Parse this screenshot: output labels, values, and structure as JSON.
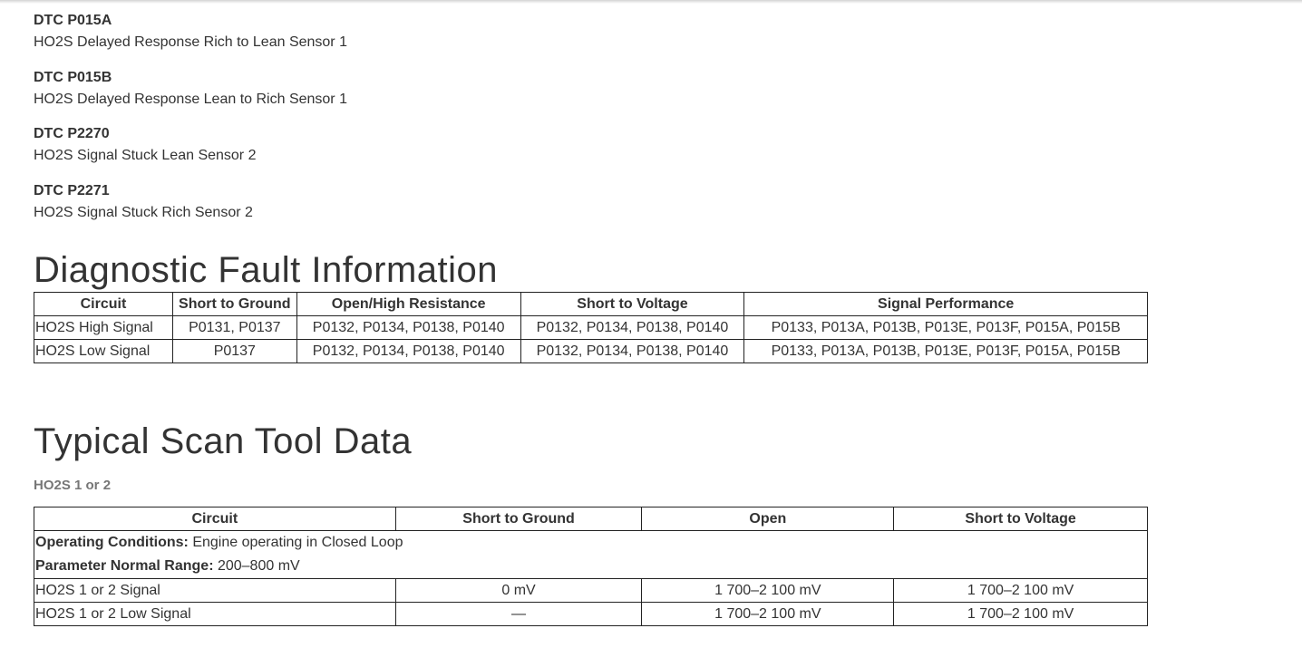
{
  "dtcs": [
    {
      "code": "DTC P015A",
      "desc": "HO2S Delayed Response Rich to Lean Sensor 1"
    },
    {
      "code": "DTC P015B",
      "desc": "HO2S Delayed Response Lean to Rich Sensor 1"
    },
    {
      "code": "DTC P2270",
      "desc": "HO2S Signal Stuck Lean Sensor 2"
    },
    {
      "code": "DTC P2271",
      "desc": "HO2S Signal Stuck Rich Sensor 2"
    }
  ],
  "fault_info": {
    "title": "Diagnostic Fault Information",
    "headers": [
      "Circuit",
      "Short to Ground",
      "Open/High Resistance",
      "Short to Voltage",
      "Signal Performance"
    ],
    "rows": [
      [
        "HO2S High Signal",
        "P0131, P0137",
        "P0132, P0134, P0138, P0140",
        "P0132, P0134, P0138, P0140",
        "P0133, P013A, P013B, P013E, P013F, P015A, P015B"
      ],
      [
        "HO2S Low Signal",
        "P0137",
        "P0132, P0134, P0138, P0140",
        "P0132, P0134, P0138, P0140",
        "P0133, P013A, P013B, P013E, P013F, P015A, P015B"
      ]
    ]
  },
  "scan_data": {
    "title": "Typical Scan Tool Data",
    "subtitle": "HO2S 1 or 2",
    "headers": [
      "Circuit",
      "Short to Ground",
      "Open",
      "Short to Voltage"
    ],
    "conditions": {
      "operating_label": "Operating Conditions:",
      "operating_value": " Engine operating in Closed Loop",
      "range_label": "Parameter Normal Range:",
      "range_value": " 200–800 mV"
    },
    "rows": [
      [
        "HO2S 1 or 2 Signal",
        "0 mV",
        "1 700–2 100 mV",
        "1 700–2 100 mV"
      ],
      [
        "HO2S 1 or 2 Low Signal",
        "—",
        "1 700–2 100 mV",
        "1 700–2 100 mV"
      ]
    ]
  }
}
